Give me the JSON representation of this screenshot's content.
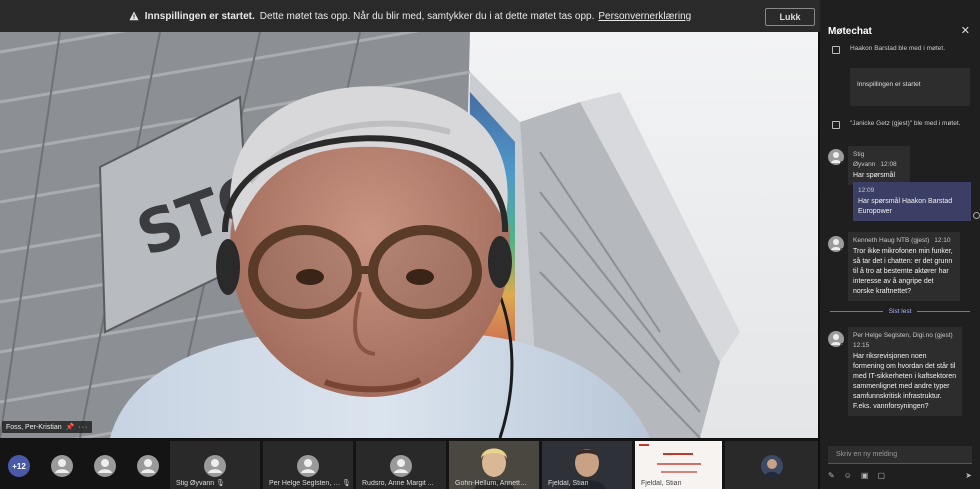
{
  "banner": {
    "bold": "Innspillingen er startet.",
    "text": "Dette møtet tas opp. Når du blir med, samtykker du i at dette møtet tas opp.",
    "link": "Personvernerklæring",
    "close_label": "Lukk"
  },
  "stage": {
    "speaker_name": "Foss, Per-Kristian",
    "pin_glyph": "📌",
    "more_glyph": "···"
  },
  "gallery": {
    "overflow_count": "+12",
    "tiles": [
      {
        "name": "Stig Øyvann"
      },
      {
        "name": "Per Helge Seglsten, Di..."
      },
      {
        "name": "Rudsro, Anne Margit ..."
      },
      {
        "name": "Gohn-Hellum, Annette..."
      },
      {
        "name": "Fjeldal, Stian"
      },
      {
        "name": "Fjeldal, Stian"
      },
      {
        "name": ""
      }
    ],
    "mic_glyph": "🎙"
  },
  "chat": {
    "title": "Møtechat",
    "close_glyph": "✕",
    "system": [
      {
        "text": "Haakon Barstad ble med i møtet."
      },
      {
        "text": "\"Janicke Getz (gjest)\" ble med i møtet."
      }
    ],
    "recording_card": "Innspillingen er startet",
    "messages": [
      {
        "author": "Stig Øyvann",
        "time": "12:08",
        "text": "Har spørsmål"
      },
      {
        "author": "",
        "time": "12:09",
        "text": "Har spørsmål Haakon Barstad Europower"
      },
      {
        "author": "Kenneth Haug NTB (gjest)",
        "time": "12:10",
        "text": "Tror ikke mikrofonen min funker, så tar det i chatten: er det grunn til å tro at bestemte aktører har interesse av å angripe det norske kraftnettet?"
      },
      {
        "author": "Per Helge Seglsten, Digi.no (gjest)",
        "time": "12:15",
        "text": "Har riksrevisjonen noen formening om hvordan det står til med IT-sikkerheten i kaftsektoren sammenlignet med andre typer samfunnskritisk infrastruktur. F.eks. vannforsyningen?"
      }
    ],
    "divider": "Sist lest",
    "compose_placeholder": "Skriv en ny melding",
    "toolbar": [
      "format-icon",
      "emoji-icon",
      "gif-icon",
      "sticker-icon",
      "send-icon"
    ]
  },
  "colors": {
    "accent": "#4a5aa8",
    "own_bubble": "#3b3f66",
    "divider": "#a9b3ff",
    "status_red": "#d4404a"
  }
}
